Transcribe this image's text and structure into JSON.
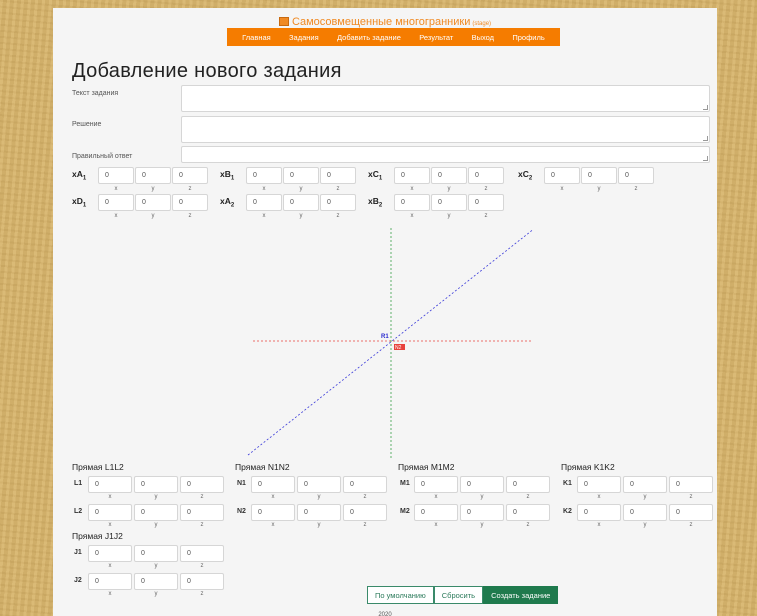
{
  "brand": {
    "title": "Самосовмещенные многогранники",
    "subtitle": "(stage)"
  },
  "nav": [
    "Главная",
    "Задания",
    "Добавить задание",
    "Результат",
    "Выход",
    "Профиль"
  ],
  "page_title": "Добавление нового задания",
  "form": {
    "task_text_label": "Текст задания",
    "solution_label": "Решение",
    "answer_label": "Правильный ответ"
  },
  "axes": {
    "x": "x",
    "y": "y",
    "z": "z"
  },
  "points": [
    {
      "label": "xA",
      "sub": "1",
      "x": "0",
      "y": "0",
      "z": "0"
    },
    {
      "label": "xB",
      "sub": "1",
      "x": "0",
      "y": "0",
      "z": "0"
    },
    {
      "label": "xC",
      "sub": "1",
      "x": "0",
      "y": "0",
      "z": "0"
    },
    {
      "label": "xC",
      "sub": "2",
      "x": "0",
      "y": "0",
      "z": "0"
    },
    {
      "label": "xD",
      "sub": "1",
      "x": "0",
      "y": "0",
      "z": "0"
    },
    {
      "label": "xA",
      "sub": "2",
      "x": "0",
      "y": "0",
      "z": "0"
    },
    {
      "label": "xB",
      "sub": "2",
      "x": "0",
      "y": "0",
      "z": "0"
    }
  ],
  "graph": {
    "label_r": "R1",
    "label_n": "N2",
    "color_x": "#e8413c",
    "color_y": "#3aa04a",
    "color_diag": "#3b3bd9"
  },
  "lines": [
    {
      "title": "Прямая L1L2",
      "p1": "L1",
      "p2": "L2"
    },
    {
      "title": "Прямая N1N2",
      "p1": "N1",
      "p2": "N2"
    },
    {
      "title": "Прямая M1M2",
      "p1": "M1",
      "p2": "M2"
    },
    {
      "title": "Прямая K1K2",
      "p1": "K1",
      "p2": "K2"
    },
    {
      "title": "Прямая J1J2",
      "p1": "J1",
      "p2": "J2"
    }
  ],
  "zero": "0",
  "buttons": {
    "default": "По умолчанию",
    "reset": "Сбросить",
    "create": "Создать задание"
  },
  "footer": "2020"
}
